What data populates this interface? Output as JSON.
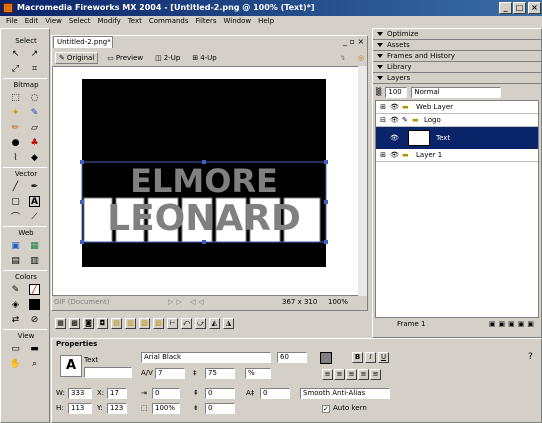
{
  "window": {
    "title": "Macromedia Fireworks MX 2004 - [Untitled-2.png @ 100% (Text)*]",
    "min": "_",
    "max": "□",
    "close": "×"
  },
  "menu": [
    "File",
    "Edit",
    "View",
    "Select",
    "Modify",
    "Text",
    "Commands",
    "Filters",
    "Window",
    "Help"
  ],
  "tools": {
    "select": "Select",
    "bitmap": "Bitmap",
    "vector": "Vector",
    "web": "Web",
    "colors": "Colors",
    "view": "View"
  },
  "document": {
    "tab": "Untitled-2.png*",
    "views": [
      "Original",
      "Preview",
      "2-Up",
      "4-Up"
    ],
    "status_left": "GIF (Document)",
    "size": "367 x 310",
    "zoom": "100%"
  },
  "canvas": {
    "line1": "ELMORE",
    "line2": "LEONARD"
  },
  "panels": [
    "Optimize",
    "Assets",
    "Frames and History",
    "Library",
    "Layers"
  ],
  "layers": {
    "opacity": "100",
    "blend": "Normal",
    "rows": [
      {
        "name": "Web Layer"
      },
      {
        "name": "Logo"
      },
      {
        "name": "Text"
      },
      {
        "name": "Layer 1"
      }
    ],
    "frame": "Frame 1"
  },
  "properties": {
    "title": "Properties",
    "object": "Text",
    "font": "Arial Black",
    "size": "60",
    "kerning": "7",
    "leading": "75",
    "leading_unit": "%",
    "w": "333",
    "x": "17",
    "h": "113",
    "y": "123",
    "scale": "100%",
    "indent": "0",
    "space_before": "0",
    "space_after": "0",
    "baseline": "0",
    "antialias": "Smooth Anti-Alias",
    "autokern": "Auto kern",
    "bold": "B",
    "italic": "I",
    "underline": "U"
  },
  "colors": {
    "titlebar": "#0a246a",
    "canvas": "#000000",
    "letters": "#808080",
    "selection": "#0a246a"
  }
}
